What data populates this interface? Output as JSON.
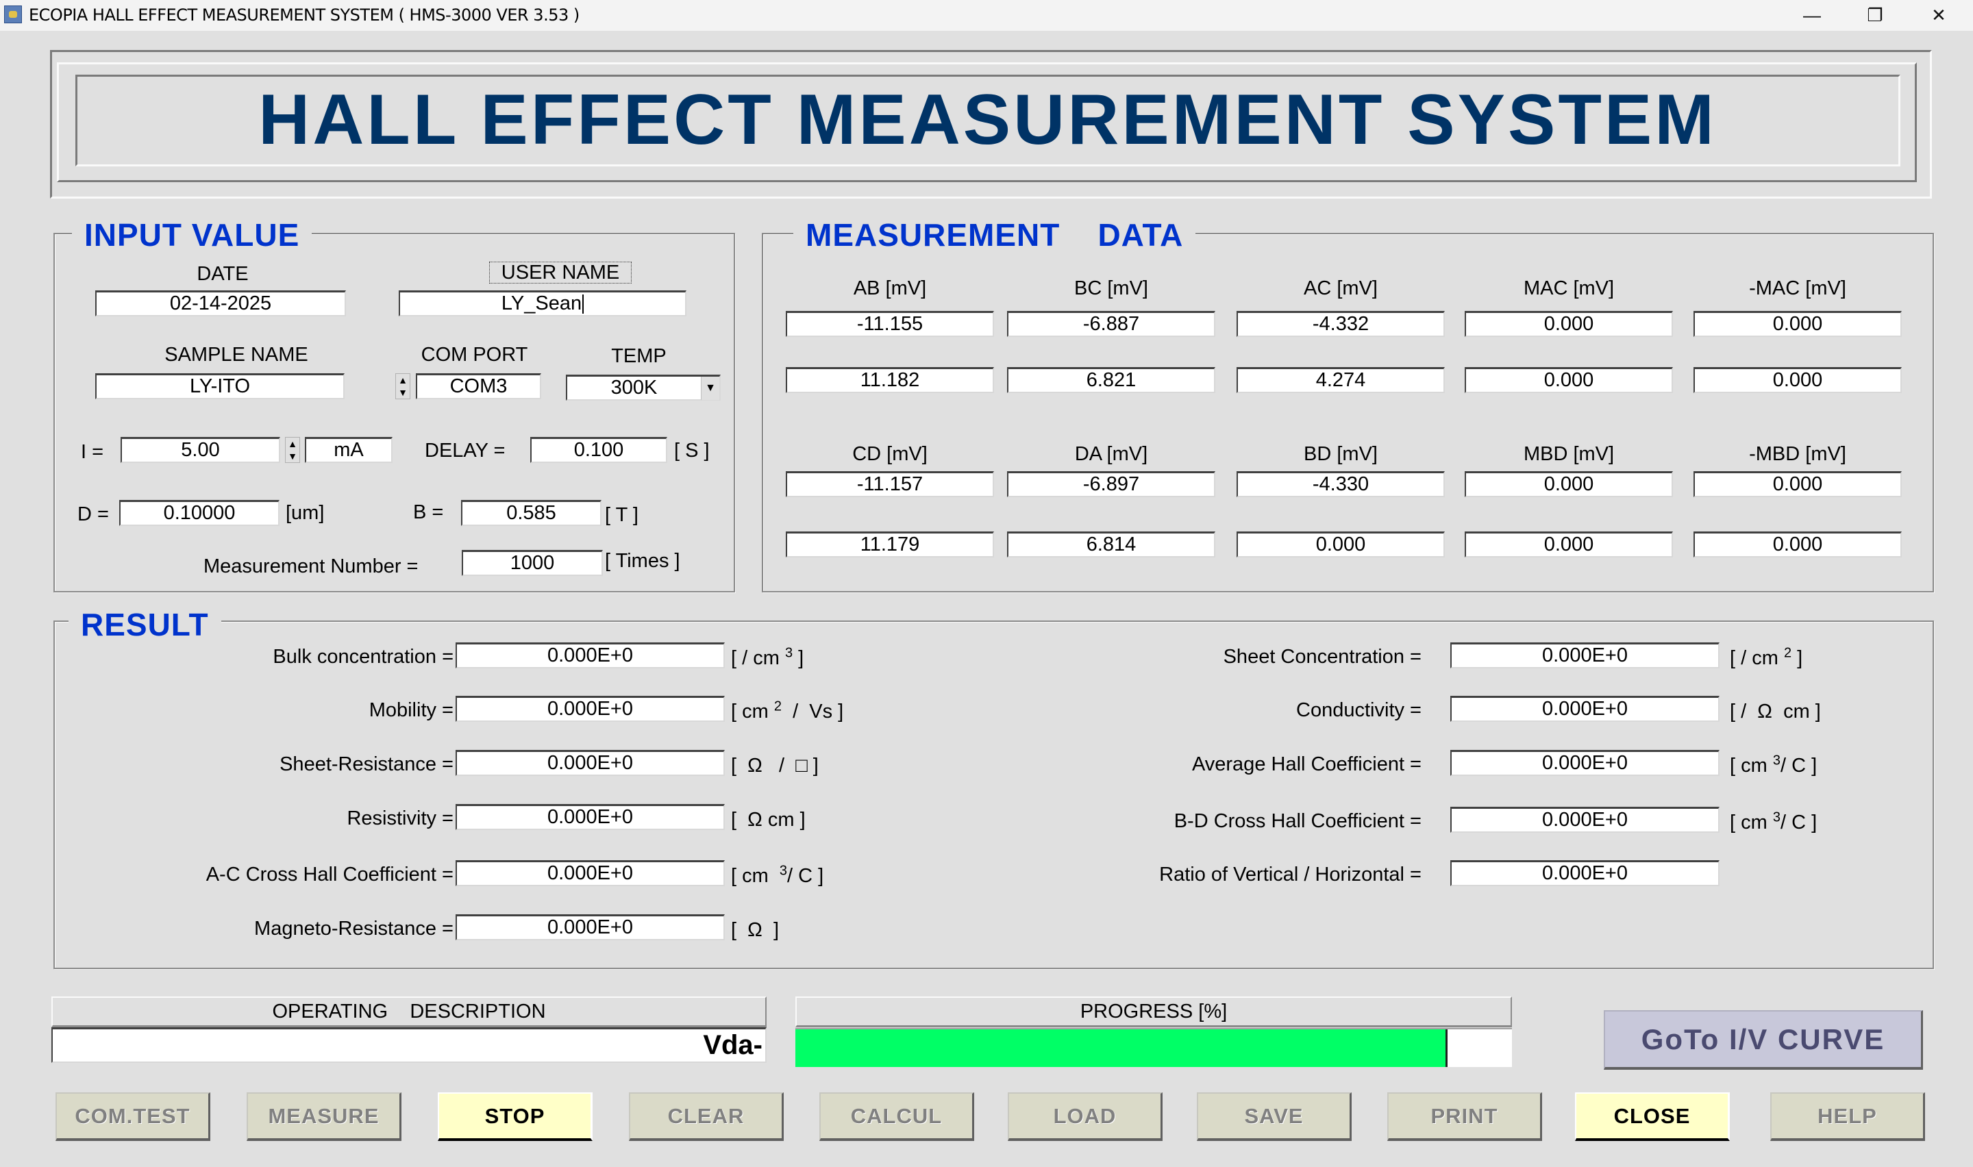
{
  "window": {
    "title": "ECOPIA HALL EFFECT MEASUREMENT SYSTEM ( HMS-3000  VER 3.53 )",
    "minimize_glyph": "—",
    "restore_glyph": "❐",
    "close_glyph": "✕"
  },
  "banner": {
    "title": "HALL EFFECT MEASUREMENT SYSTEM"
  },
  "input": {
    "legend": "INPUT VALUE",
    "date_label": "DATE",
    "date_value": "02-14-2025",
    "user_label": "USER NAME",
    "user_value": "LY_Sean",
    "sample_label": "SAMPLE NAME",
    "sample_value": "LY-ITO",
    "com_label": "COM PORT",
    "com_value": "COM3",
    "temp_label": "TEMP",
    "temp_value": "300K",
    "current_label": "I  =",
    "current_value": "5.00",
    "current_unit": "mA",
    "delay_label": "DELAY =",
    "delay_value": "0.100",
    "delay_unit": "[ S ]",
    "d_label": "D =",
    "d_value": "0.10000",
    "d_unit": "[um]",
    "b_label": "B =",
    "b_value": "0.585",
    "b_unit": "[ T ]",
    "meas_num_label": "Measurement Number  =",
    "meas_num_value": "1000",
    "meas_num_unit": "[ Times ]"
  },
  "measurement": {
    "legend": "MEASUREMENT    DATA",
    "group1": {
      "headers": [
        "AB [mV]",
        "BC [mV]",
        "AC [mV]",
        "MAC [mV]",
        "-MAC [mV]"
      ],
      "row1": [
        "-11.155",
        "-6.887",
        "-4.332",
        "0.000",
        "0.000"
      ],
      "row2": [
        "11.182",
        "6.821",
        "4.274",
        "0.000",
        "0.000"
      ]
    },
    "group2": {
      "headers": [
        "CD [mV]",
        "DA [mV]",
        "BD [mV]",
        "MBD [mV]",
        "-MBD [mV]"
      ],
      "row1": [
        "-11.157",
        "-6.897",
        "-4.330",
        "0.000",
        "0.000"
      ],
      "row2": [
        "11.179",
        "6.814",
        "0.000",
        "0.000",
        "0.000"
      ]
    }
  },
  "result": {
    "legend": "RESULT",
    "left": [
      {
        "label": "Bulk concentration =",
        "value": "0.000E+0",
        "unit_pre": "[ / cm ",
        "unit_sup": "3",
        "unit_post": " ]"
      },
      {
        "label": "Mobility =",
        "value": "0.000E+0",
        "unit_pre": "[ cm ",
        "unit_sup": "2",
        "unit_post": "  /  Vs ]"
      },
      {
        "label": "Sheet-Resistance =",
        "value": "0.000E+0",
        "unit_pre": "[  Ω   /  □ ]",
        "unit_sup": "",
        "unit_post": ""
      },
      {
        "label": "Resistivity =",
        "value": "0.000E+0",
        "unit_pre": "[  Ω cm ]",
        "unit_sup": "",
        "unit_post": ""
      },
      {
        "label": "A-C Cross Hall Coefficient =",
        "value": "0.000E+0",
        "unit_pre": "[ cm  ",
        "unit_sup": "3",
        "unit_post": "/ C ]"
      },
      {
        "label": "Magneto-Resistance =",
        "value": "0.000E+0",
        "unit_pre": "[  Ω  ]",
        "unit_sup": "",
        "unit_post": ""
      }
    ],
    "right": [
      {
        "label": "Sheet Concentration =",
        "value": "0.000E+0",
        "unit_pre": "[ / cm ",
        "unit_sup": "2",
        "unit_post": " ]"
      },
      {
        "label": "Conductivity =",
        "value": "0.000E+0",
        "unit_pre": "[ /  Ω  cm ]",
        "unit_sup": "",
        "unit_post": ""
      },
      {
        "label": "Average Hall Coefficient =",
        "value": "0.000E+0",
        "unit_pre": "[ cm ",
        "unit_sup": "3",
        "unit_post": "/ C ]"
      },
      {
        "label": "B-D Cross Hall Coefficient =",
        "value": "0.000E+0",
        "unit_pre": "[ cm ",
        "unit_sup": "3",
        "unit_post": "/ C ]"
      },
      {
        "label": "Ratio of Vertical / Horizontal =",
        "value": "0.000E+0",
        "unit_pre": "",
        "unit_sup": "",
        "unit_post": ""
      }
    ]
  },
  "status": {
    "op_desc_label": "OPERATING    DESCRIPTION",
    "op_desc_value": "Vda-",
    "progress_label": "PROGRESS [%]",
    "progress_percent": 91,
    "progress_color": "#00ff66"
  },
  "goto_button": "GoTo I/V CURVE",
  "buttons": [
    {
      "label": "COM.TEST",
      "active": false
    },
    {
      "label": "MEASURE",
      "active": false
    },
    {
      "label": "STOP",
      "active": true
    },
    {
      "label": "CLEAR",
      "active": false
    },
    {
      "label": "CALCUL",
      "active": false
    },
    {
      "label": "LOAD",
      "active": false
    },
    {
      "label": "SAVE",
      "active": false
    },
    {
      "label": "PRINT",
      "active": false
    },
    {
      "label": "CLOSE",
      "active": true
    },
    {
      "label": "HELP",
      "active": false
    }
  ]
}
